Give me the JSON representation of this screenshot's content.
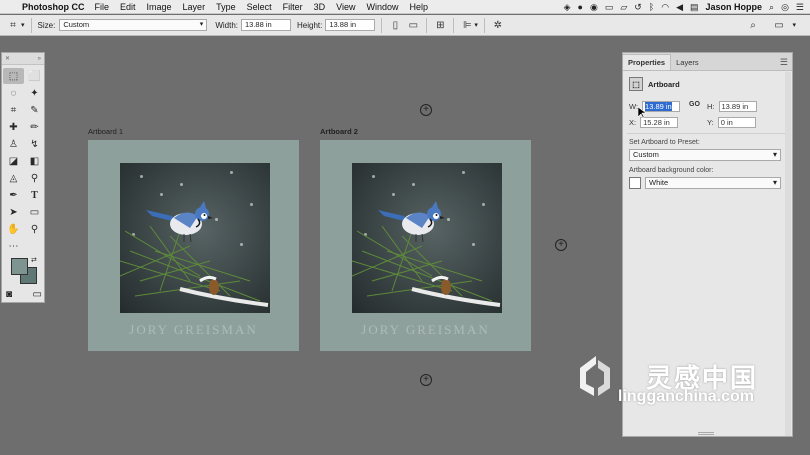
{
  "menubar": {
    "app_name": "Photoshop CC",
    "items": [
      "File",
      "Edit",
      "Image",
      "Layer",
      "Type",
      "Select",
      "Filter",
      "3D",
      "View",
      "Window",
      "Help"
    ],
    "user": "Jason Hoppe"
  },
  "options_bar": {
    "size_label": "Size:",
    "size_value": "Custom",
    "width_label": "Width:",
    "width_value": "13.88 in",
    "height_label": "Height:",
    "height_value": "13.88 in"
  },
  "canvas": {
    "artboards": [
      {
        "label": "Artboard 1",
        "watermark": "JORY GREISMAN"
      },
      {
        "label": "Artboard 2",
        "watermark": "JORY GREISMAN"
      }
    ]
  },
  "properties": {
    "tabs": [
      "Properties",
      "Layers"
    ],
    "section_title": "Artboard",
    "w_label": "W:",
    "w_value": "13.89 in",
    "link_label": "GO",
    "h_label": "H:",
    "h_value": "13.89 in",
    "x_label": "X:",
    "x_value": "15.28 in",
    "y_label": "Y:",
    "y_value": "0 in",
    "preset_label": "Set Artboard to Preset:",
    "preset_value": "Custom",
    "bg_label": "Artboard background color:",
    "bg_value": "White"
  },
  "logo": {
    "chinese": "灵感中国",
    "url": "lingganchina.com"
  },
  "colors": {
    "foreground": "#7e9490",
    "background": "#5f7875",
    "selection": "#2d6bd1",
    "artboard_fill": "#8ea09c"
  }
}
